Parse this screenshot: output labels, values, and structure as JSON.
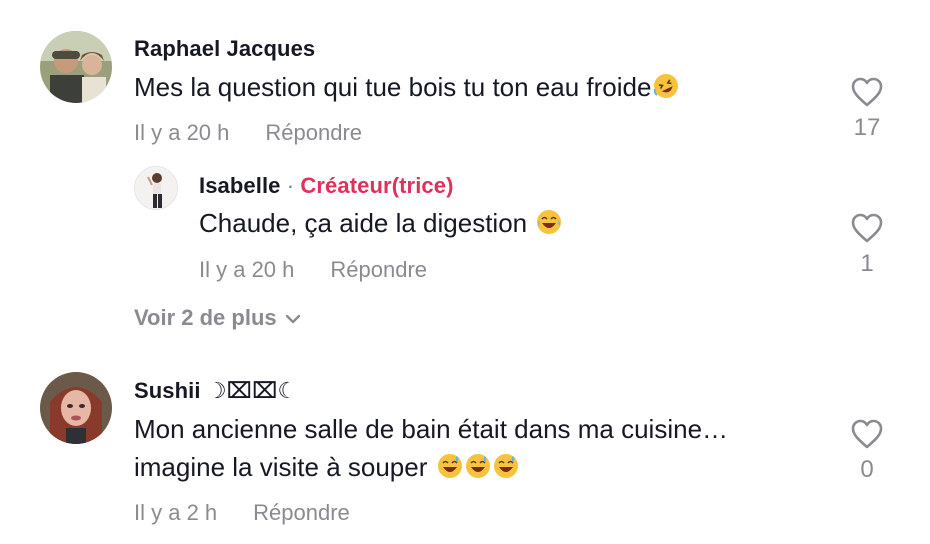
{
  "comments": [
    {
      "username": "Raphael Jacques",
      "text": "Mes la question qui tue bois tu ton eau froide",
      "emoji": "rofl-emoji",
      "time": "Il y a 20 h",
      "reply_label": "Répondre",
      "likes": "17"
    },
    {
      "username": "Isabelle",
      "separator": "·",
      "creator_label": "Créateur(trice)",
      "text": "Chaude, ça aide la digestion",
      "emoji": "joy-emoji",
      "time": "Il y a 20 h",
      "reply_label": "Répondre",
      "likes": "1"
    },
    {
      "username": "Sushii ☽⌧⌧☾",
      "text_line1": "Mon ancienne salle de bain était dans ma cuisine…",
      "text_line2": "imagine la visite à souper",
      "emoji": "sweat-smile-emoji",
      "time": "Il y a 2 h",
      "reply_label": "Répondre",
      "likes": "0"
    }
  ],
  "view_more": {
    "label": "Voir 2 de plus"
  },
  "colors": {
    "text": "#161823",
    "muted": "#8a8b91",
    "creator": "#e0305b"
  }
}
